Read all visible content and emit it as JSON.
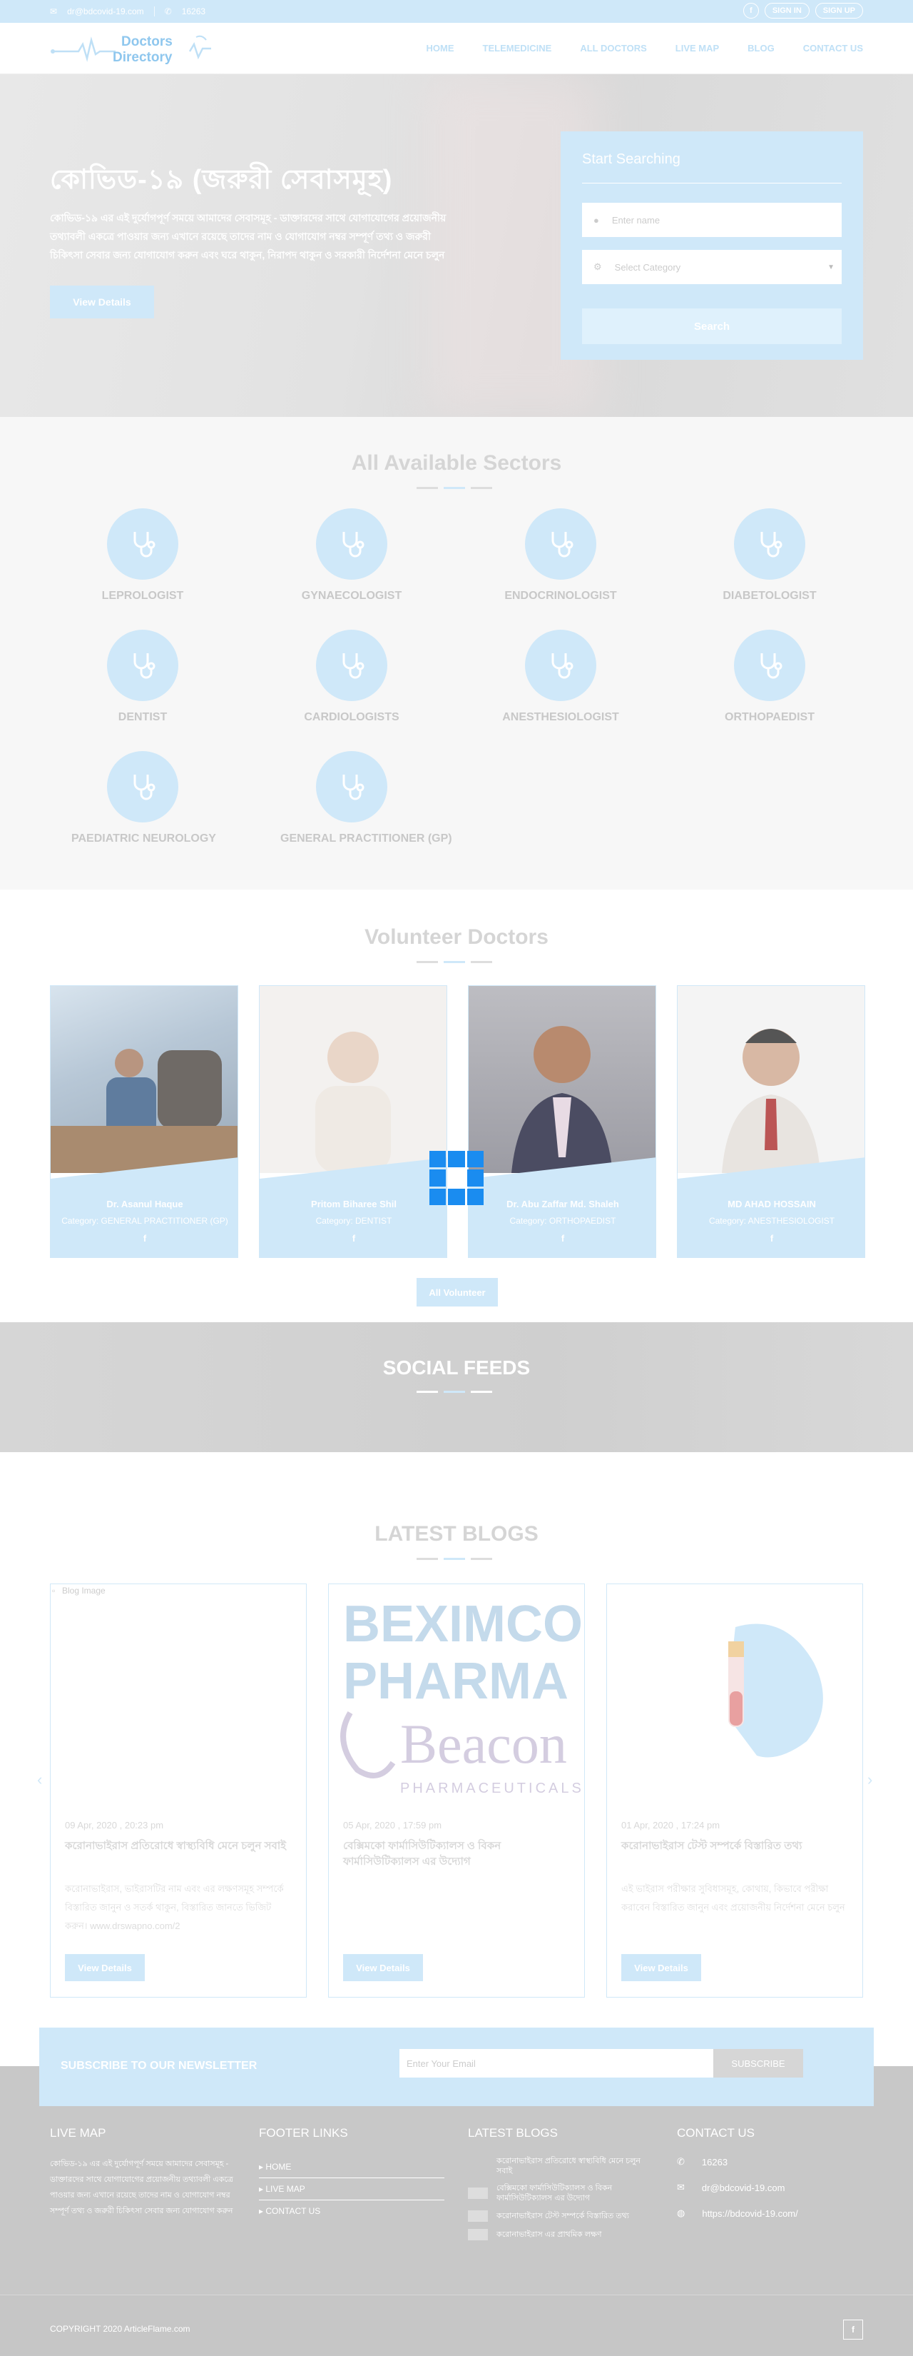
{
  "topbar": {
    "email": "dr@bdcovid-19.com",
    "phone": "16263",
    "facebook_glyph": "f",
    "sign_in": "SIGN IN",
    "sign_up": "SIGN UP"
  },
  "logo": {
    "line1": "Doctors",
    "line2": "Directory"
  },
  "nav": {
    "items": [
      "HOME",
      "TELEMEDICINE",
      "ALL DOCTORS",
      "LIVE MAP",
      "BLOG",
      "CONTACT US"
    ]
  },
  "hero": {
    "title": "কোভিড-১৯ (জরুরী সেবাসমূহ)",
    "text": "কোভিড-১৯ এর এই দুর্যোগপূর্ণ সময়ে আমাদের সেবাসমূহ - ডাক্তারদের সাথে যোগাযোগের প্রয়োজনীয় তথ্যাবলী একত্রে পাওয়ার জন্য এখানে রয়েছে তাদের নাম ও যোগাযোগ নম্বর সম্পূর্ণ তথ্য ও জরুরী চিকিৎসা সেবার জন্য যোগাযোগ করুন এবং ঘরে থাকুন, নিরাপদ থাকুন ও সরকারী নির্দেশনা মেনে চলুন",
    "button": "View Details"
  },
  "search": {
    "title": "Start Searching",
    "name_placeholder": "Enter name",
    "category_placeholder": "Select Category",
    "button": "Search"
  },
  "sectors": {
    "title": "All Available Sectors",
    "items": [
      "LEPROLOGIST",
      "GYNAECOLOGIST",
      "ENDOCRINOLOGIST",
      "DIABETOLOGIST",
      "DENTIST",
      "CARDIOLOGISTS",
      "ANESTHESIOLOGIST",
      "ORTHOPAEDIST",
      "PAEDIATRIC NEUROLOGY",
      "GENERAL PRACTITIONER (GP)"
    ]
  },
  "volunteers": {
    "title": "Volunteer Doctors",
    "cards": [
      {
        "name": "Dr. Asanul Haque",
        "category": "Category: GENERAL PRACTITIONER (GP)"
      },
      {
        "name": "Pritom Biharee Shil",
        "category": "Category: DENTIST"
      },
      {
        "name": "Dr. Abu Zaffar Md. Shaleh",
        "category": "Category: ORTHOPAEDIST"
      },
      {
        "name": "MD AHAD HOSSAIN",
        "category": "Category: ANESTHESIOLOGIST"
      }
    ],
    "button": "All Volunteer"
  },
  "social": {
    "title": "SOCIAL FEEDS"
  },
  "blogs": {
    "title": "LATEST BLOGS",
    "cards": [
      {
        "img_alt": "Blog Image",
        "date": "09 Apr, 2020 , 20:23 pm",
        "title": "করোনাভাইরাস প্রতিরোধে স্বাস্থ্যবিধি মেনে চলুন সবাই",
        "excerpt": "করোনাভাইরাস, ভাইরাসটির নাম এবং এর লক্ষণসমূহ সম্পর্কে বিস্তারিত জানুন ও সতর্ক থাকুন, বিস্তারিত জানতে ভিজিট করুন। www.drswapno.com/2",
        "button": "View Details"
      },
      {
        "img_alt": "",
        "date": "05 Apr, 2020 , 17:59 pm",
        "title": "বেক্সিমকো ফার্মাসিউটিক্যালস ও বিকন ফার্মাসিউটিক্যালস এর উদ্যোগ",
        "excerpt": "",
        "button": "View Details"
      },
      {
        "img_alt": "",
        "date": "01 Apr, 2020 , 17:24 pm",
        "title": "করোনাভাইরাস টেস্ট সম্পর্কে বিস্তারিত তথ্য",
        "excerpt": "এই ভাইরাস পরীক্ষার সুবিধাসমূহ, কোথায়, কিভাবে পরীক্ষা করাবেন বিস্তারিত জানুন এবং প্রয়োজনীয় নির্দেশনা মেনে চলুন",
        "button": "View Details"
      }
    ]
  },
  "newsletter": {
    "title": "SUBSCRIBE TO OUR NEWSLETTER",
    "placeholder": "Enter Your Email",
    "button": "SUBSCRIBE"
  },
  "footer": {
    "live_map": {
      "title": "LIVE MAP",
      "text": "কোভিড-১৯ এর এই দুর্যোগপূর্ণ সময়ে আমাদের সেবাসমূহ - ডাক্তারদের সাথে যোগাযোগের প্রয়োজনীয় তথ্যাবলী একত্রে পাওয়ার জন্য এখানে রয়েছে তাদের নাম ও যোগাযোগ নম্বর সম্পূর্ণ তথ্য ও জরুরী চিকিৎসা সেবার জন্য যোগাযোগ করুন"
    },
    "links": {
      "title": "FOOTER LINKS",
      "items": [
        "HOME",
        "LIVE MAP",
        "CONTACT US"
      ]
    },
    "blogs": {
      "title": "LATEST BLOGS",
      "items": [
        "করোনাভাইরাস প্রতিরোধে স্বাস্থ্যবিধি মেনে চলুন সবাই",
        "বেক্সিমকো ফার্মাসিউটিক্যালস ও বিকন ফার্মাসিউটিক্যালস এর উদ্যোগ",
        "করোনাভাইরাস টেস্ট সম্পর্কে বিস্তারিত তথ্য",
        "করোনাভাইরাস এর প্রাথমিক লক্ষণ"
      ]
    },
    "contact": {
      "title": "CONTACT US",
      "phone": "16263",
      "email": "dr@bdcovid-19.com",
      "website": "https://bdcovid-19.com/"
    },
    "copyright": "COPYRIGHT 2020",
    "brand": "ArticleFlame.com"
  }
}
